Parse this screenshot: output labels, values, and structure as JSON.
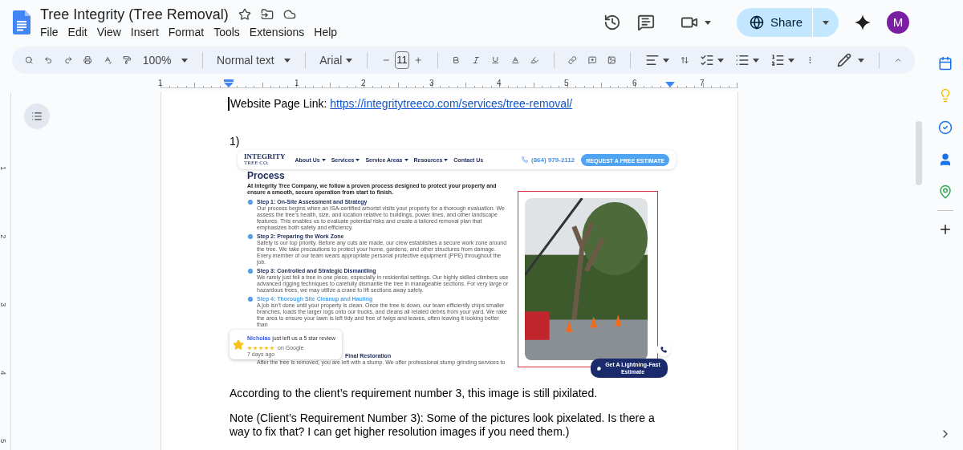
{
  "title": "Tree Integrity (Tree Removal)",
  "menu": [
    "File",
    "Edit",
    "View",
    "Insert",
    "Format",
    "Tools",
    "Extensions",
    "Help"
  ],
  "toolbar": {
    "zoom": "100%",
    "style": "Normal text",
    "font": "Arial",
    "font_size": "11"
  },
  "share": {
    "label": "Share"
  },
  "account": {
    "initial": "M"
  },
  "ruler": {
    "marks": [
      "1",
      "1",
      "2",
      "3",
      "4",
      "5",
      "6",
      "7"
    ]
  },
  "vertical_ruler": {
    "marks": [
      "1",
      "2",
      "3",
      "4",
      "5"
    ]
  },
  "document": {
    "link_line": {
      "label": "Website Page Link: ",
      "url": "https://integritytreeco.com/services/tree-removal/"
    },
    "list_number": "1)",
    "screenshot": {
      "logo": {
        "name": "INTEGRITY",
        "sub": "TREE CO."
      },
      "nav": [
        {
          "label": "About Us",
          "has_menu": true
        },
        {
          "label": "Services",
          "has_menu": true
        },
        {
          "label": "Service Areas",
          "has_menu": true
        },
        {
          "label": "Resources",
          "has_menu": true
        },
        {
          "label": "Contact Us",
          "has_menu": false
        }
      ],
      "phone": "(864) 979-2112",
      "cta": "REQUEST A FREE ESTIMATE",
      "heading": "Process",
      "intro": "At Integrity Tree Company, we follow a proven process designed to protect your property and ensure a smooth, secure operation from start to finish.",
      "steps": [
        {
          "kind": "step",
          "title": "Step 1: On-Site Assessment and Strategy",
          "highlighted": false,
          "text": "Our process begins when an ISA-certified arborist visits your property for a thorough evaluation. We assess the tree’s health, size, and location relative to buildings, power lines, and other landscape features. This enables us to evaluate potential risks and create a tailored removal plan that emphasizes both safety and efficiency."
        },
        {
          "kind": "step",
          "title": "Step 2: Preparing the Work Zone",
          "highlighted": false,
          "text": "Safety is our top priority. Before any cuts are made, our crew establishes a secure work zone around the tree. We take precautions to protect your home, gardens, and other structures from damage. Every member of our team wears appropriate personal protective equipment (PPE) throughout the job."
        },
        {
          "kind": "step",
          "title": "Step 3: Controlled and Strategic Dismantling",
          "highlighted": false,
          "text": "We rarely just fell a tree in one piece, especially in residential settings. Our highly skilled climbers use advanced rigging techniques to carefully dismantle the tree in manageable sections. For very large or hazardous trees, we may utilize a crane to lift sections away safely."
        },
        {
          "kind": "step",
          "title": "Step 4: Thorough Site Cleanup and Hauling",
          "highlighted": true,
          "text": "A job isn’t done until your property is clean. Once the tree is down, our team efficiently chips smaller branches, loads the larger logs onto our trucks, and cleans all related debris from your yard. We rake the area to ensure your lawn is left tidy and free of twigs and leaves, often leaving it looking better than"
        },
        {
          "kind": "covered",
          "title": "Final Restoration",
          "highlighted": false,
          "text": "After the tree is removed, you are left with a stump. We offer professional stump grinding services to"
        }
      ],
      "review": {
        "name": "Nicholas",
        "text": "just left us a 5 star review",
        "stars": 5,
        "source": "on Google",
        "time": "7 days ago"
      },
      "chat_button": "Get A Lightning-Fast Estimate"
    },
    "paragraphs": [
      "According to the client’s requirement number 3, this image is still pixilated.",
      "Note (Client’s Requirement Number 3): Some of the pictures look pixelated. Is there a way to fix that? I can get higher resolution images if you need them.)"
    ]
  }
}
